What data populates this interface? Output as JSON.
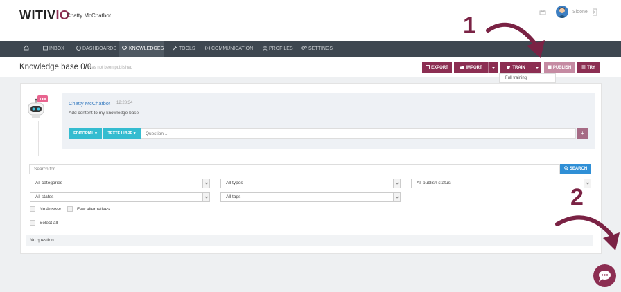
{
  "header": {
    "logo_main": "WITIV",
    "logo_accent": "IO",
    "bot_name": "Chatty McChatbot",
    "user_name": "Sidone"
  },
  "nav": {
    "items": [
      {
        "label": "",
        "icon": "home-icon"
      },
      {
        "label": "INBOX",
        "icon": "inbox-icon"
      },
      {
        "label": "DASHBOARDS",
        "icon": "dashboard-icon"
      },
      {
        "label": "KNOWLEDGES",
        "icon": "chat-bubbles-icon"
      },
      {
        "label": "TOOLS",
        "icon": "wrench-icon"
      },
      {
        "label": "COMMUNICATION",
        "icon": "broadcast-icon"
      },
      {
        "label": "PROFILES",
        "icon": "profile-icon"
      },
      {
        "label": "SETTINGS",
        "icon": "gears-icon"
      }
    ],
    "active": "KNOWLEDGES"
  },
  "page": {
    "title": "Knowledge base 0/0",
    "subtitle": "Has not been published"
  },
  "toolbar": {
    "export_label": "EXPORT",
    "import_label": "IMPORT",
    "train_label": "TRAIN",
    "publish_label": "PUBLISH",
    "try_label": "TRY",
    "train_dropdown_item": "Full training"
  },
  "chat": {
    "bot_name": "Chatty McChatbot",
    "time": "12:28:34",
    "message": "Add content to my knowledge base",
    "editorial_label": "EDITORIAL",
    "texte_libre_label": "TEXTE LIBRE",
    "question_placeholder": "Question ...",
    "add_label": "+"
  },
  "filters": {
    "search_placeholder": "Search for ...",
    "search_button": "SEARCH",
    "categories": "All categories",
    "types": "All types",
    "publish_status": "All publish status",
    "states": "All states",
    "tags": "All tags",
    "no_answer_label": "No Answer",
    "few_alternatives_label": "Few alternatives",
    "select_all_label": "Select all"
  },
  "list": {
    "empty_text": "No question"
  },
  "annotations": {
    "step1": "1",
    "step2": "2"
  },
  "colors": {
    "brand": "#8c2e52",
    "nav_bg": "#3e4750",
    "accent_blue": "#2f8fd6",
    "teal": "#34bcd0"
  }
}
